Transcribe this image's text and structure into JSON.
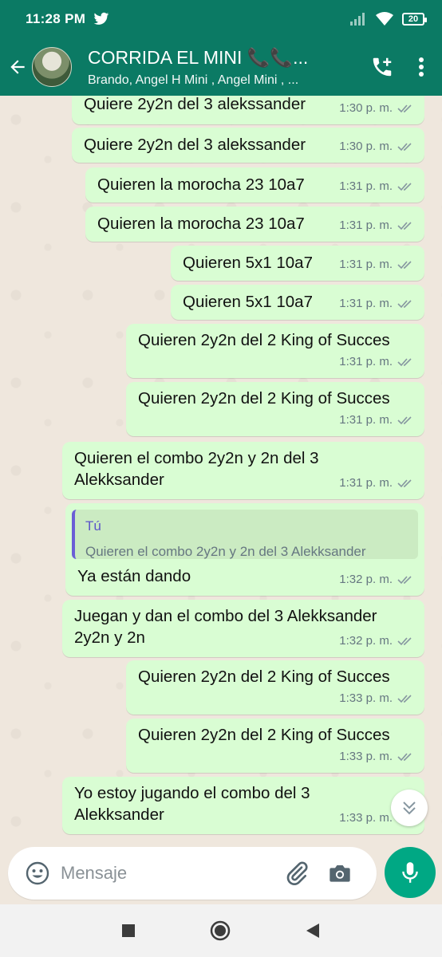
{
  "status_bar": {
    "time": "11:28 PM",
    "battery": "20"
  },
  "header": {
    "title": "CORRIDA EL MINI 📞📞...",
    "subtitle": "Brando, Angel H Mini , Angel Mini , ..."
  },
  "messages": [
    {
      "text": "Quiere 2y2n del 3 alekssander",
      "time": "1:30 p. m."
    },
    {
      "text": "Quiere 2y2n del 3 alekssander",
      "time": "1:30 p. m."
    },
    {
      "text": "Quieren la morocha 23 10a7",
      "time": "1:31 p. m."
    },
    {
      "text": "Quieren la morocha 23 10a7",
      "time": "1:31 p. m."
    },
    {
      "text": "Quieren 5x1 10a7",
      "time": "1:31 p. m."
    },
    {
      "text": "Quieren 5x1 10a7",
      "time": "1:31 p. m."
    },
    {
      "text": "Quieren 2y2n del 2 King of Succes",
      "time": "1:31 p. m."
    },
    {
      "text": "Quieren 2y2n del 2 King of Succes",
      "time": "1:31 p. m."
    },
    {
      "text": "Quieren el combo 2y2n y 2n del 3",
      "text2": "Alekksander",
      "time": "1:31 p. m."
    },
    {
      "quote_author": "Tú",
      "quote_text": "Quieren el combo 2y2n y 2n del 3 Alekksander",
      "text": "Ya están dando",
      "time": "1:32 p. m."
    },
    {
      "text": "Juegan y dan el combo del 3 Alekksander",
      "text2": "2y2n y 2n",
      "time": "1:32 p. m."
    },
    {
      "text": "Quieren 2y2n del 2 King of Succes",
      "time": "1:33 p. m."
    },
    {
      "text": "Quieren 2y2n del 2 King of Succes",
      "time": "1:33 p. m."
    },
    {
      "text": "Yo estoy jugando el combo del 3",
      "text2": "Alekksander",
      "time": "1:33 p. m."
    }
  ],
  "input": {
    "placeholder": "Mensaje"
  },
  "colors": {
    "header": "#0b7a64",
    "bubble_out": "#d9fdd3",
    "accent": "#00a884",
    "chat_bg": "#efe7dd"
  },
  "icons": [
    "back-arrow-icon",
    "add-call-icon",
    "more-vert-icon",
    "emoji-icon",
    "attach-icon",
    "camera-icon",
    "mic-icon",
    "chevron-double-down-icon"
  ]
}
